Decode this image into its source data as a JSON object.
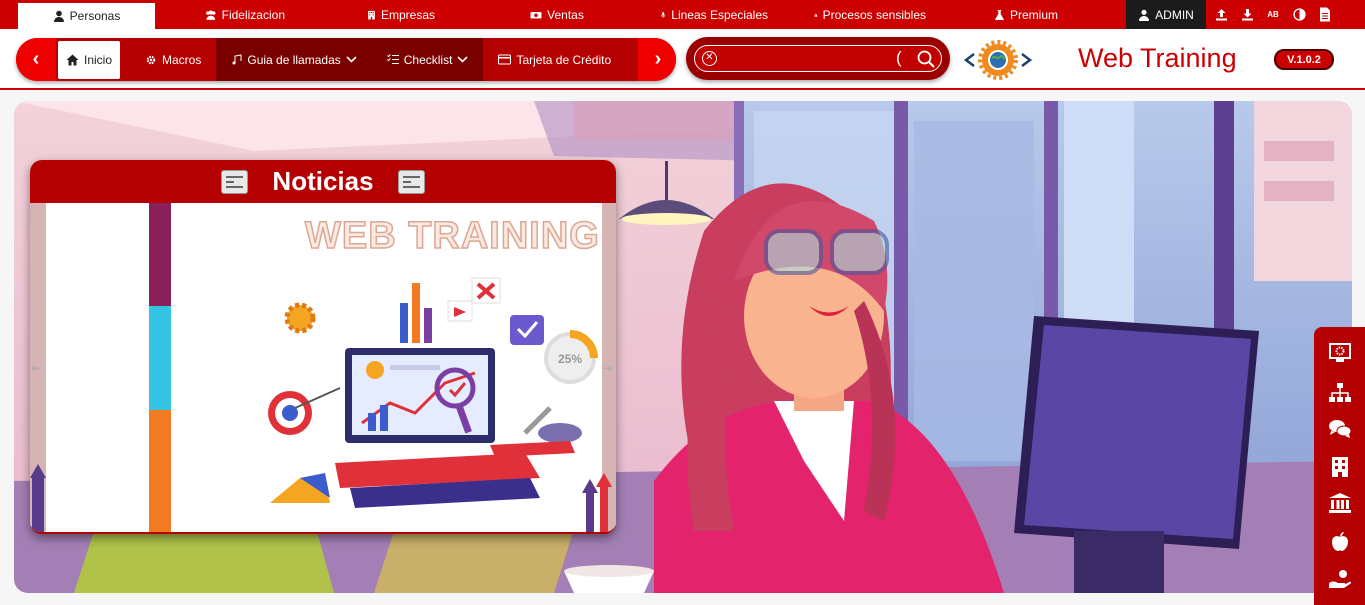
{
  "top_nav": {
    "tabs": [
      {
        "label": "Personas",
        "icon": "person-icon",
        "active": true
      },
      {
        "label": "Fidelizacion",
        "icon": "users-icon"
      },
      {
        "label": "Empresas",
        "icon": "building-icon"
      },
      {
        "label": "Ventas",
        "icon": "money-icon"
      },
      {
        "label": "Lineas Especiales",
        "icon": "microphone-icon"
      },
      {
        "label": "Procesos sensibles",
        "icon": "warning-icon"
      },
      {
        "label": "Premium",
        "icon": "flask-icon"
      }
    ],
    "admin_label": "ADMIN",
    "tools": [
      "upload-icon",
      "download-icon",
      "spellcheck-icon",
      "contrast-icon",
      "document-icon"
    ],
    "spellcheck_label": "AB"
  },
  "nav": {
    "items": [
      {
        "label": "Inicio",
        "icon": "home-icon",
        "active": true
      },
      {
        "label": "Macros",
        "icon": "gear-icon"
      },
      {
        "label": "Guia de llamadas",
        "icon": "music-note-icon",
        "has_dropdown": true
      },
      {
        "label": "Checklist",
        "icon": "checklist-icon",
        "has_dropdown": true
      },
      {
        "label": "Tarjeta de Crédito",
        "icon": "credit-card-icon"
      }
    ]
  },
  "search": {
    "value": "",
    "placeholder": ""
  },
  "brand": {
    "name": "Web Training",
    "version": "V.1.0.2"
  },
  "news": {
    "title": "Noticias",
    "slide_text": "WEB TRAINING",
    "slide_badge": "25%"
  },
  "right_sidebar": [
    "monitor-gear-icon",
    "sitemap-icon",
    "comments-icon",
    "building-icon",
    "bank-icon",
    "apple-icon",
    "hand-holding-icon"
  ],
  "colors": {
    "primary": "#cc0000",
    "dark_red": "#b40000",
    "accent_dark": "#1b1b1b"
  }
}
